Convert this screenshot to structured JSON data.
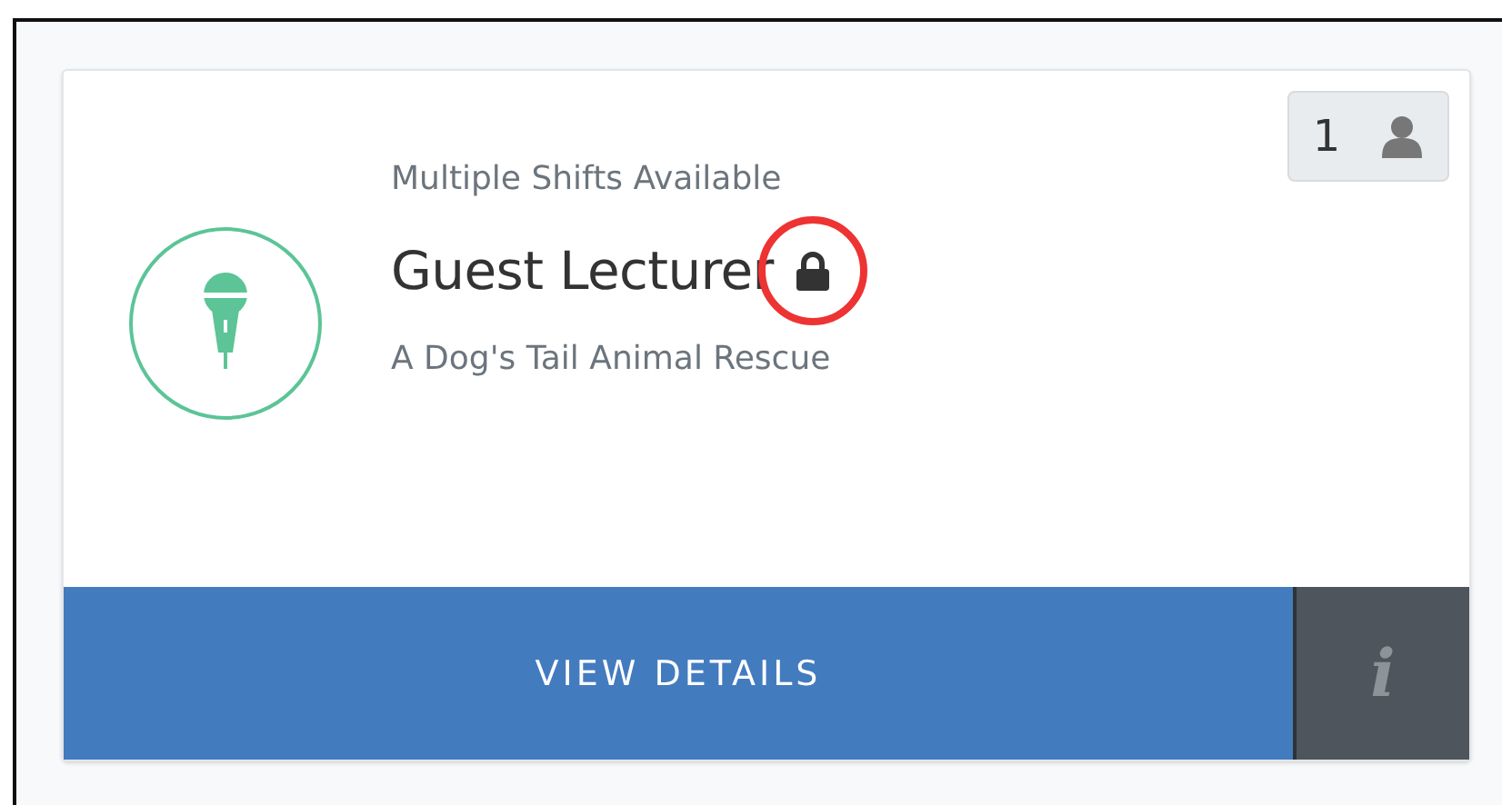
{
  "card": {
    "subtitle": "Multiple Shifts Available",
    "title": "Guest Lecturer",
    "locked": true,
    "organization": "A Dog's Tail Animal Rescue",
    "volunteer_count": "1",
    "button": "VIEW DETAILS",
    "info_button": "i"
  }
}
